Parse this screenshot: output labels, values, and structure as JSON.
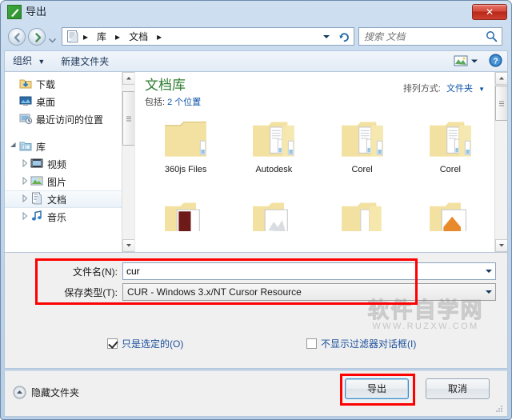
{
  "window": {
    "title": "导出",
    "icon": "export-app-icon",
    "close_label": "✕"
  },
  "nav": {
    "back_icon": "back-arrow-icon",
    "forward_icon": "forward-arrow-icon",
    "recent_icon": "recent-pages-chevron-icon",
    "address_icon": "document-library-icon",
    "breadcrumbs": [
      "库",
      "文档"
    ],
    "separator": "▸",
    "dropdown_icon": "address-dropdown-icon",
    "refresh_icon": "refresh-icon"
  },
  "search": {
    "placeholder": "搜索 文档",
    "value": "",
    "icon": "search-icon"
  },
  "command_bar": {
    "organize_label": "组织",
    "organize_arrow": "▼",
    "new_folder_label": "新建文件夹",
    "view_icon": "view-mode-icon",
    "view_arrow_icon": "view-dropdown-icon",
    "help_icon": "help-icon"
  },
  "sidebar": {
    "items": [
      {
        "label": "下载",
        "icon": "downloads-icon",
        "indent": 18,
        "expander": "",
        "selected": false
      },
      {
        "label": "桌面",
        "icon": "desktop-icon",
        "indent": 18,
        "expander": "",
        "selected": false
      },
      {
        "label": "最近访问的位置",
        "icon": "recent-places-icon",
        "indent": 18,
        "expander": "",
        "selected": false
      },
      {
        "label": "",
        "icon": "spacer",
        "indent": 0,
        "expander": "",
        "selected": false
      },
      {
        "label": "库",
        "icon": "libraries-icon",
        "indent": 4,
        "expander": "expanded",
        "selected": false
      },
      {
        "label": "视频",
        "icon": "videos-icon",
        "indent": 18,
        "expander": "collapsed",
        "selected": false
      },
      {
        "label": "图片",
        "icon": "pictures-icon",
        "indent": 18,
        "expander": "collapsed",
        "selected": false
      },
      {
        "label": "文档",
        "icon": "documents-icon",
        "indent": 18,
        "expander": "collapsed",
        "selected": true
      },
      {
        "label": "音乐",
        "icon": "music-icon",
        "indent": 18,
        "expander": "collapsed",
        "selected": false
      }
    ]
  },
  "library": {
    "title": "文档库",
    "subtitle_prefix": "包括:",
    "subtitle_link": "2 个位置",
    "arrange_label": "排列方式:",
    "arrange_value": "文件夹",
    "arrange_arrow": "▼"
  },
  "files": {
    "row1": [
      {
        "name": "360js Files",
        "icon": "folder-empty-icon"
      },
      {
        "name": "Autodesk",
        "icon": "folder-documents-icon"
      },
      {
        "name": "Corel",
        "icon": "folder-documents-icon"
      },
      {
        "name": "Corel",
        "icon": "folder-documents-icon"
      }
    ],
    "row2": [
      {
        "name": "",
        "icon": "folder-dark-preview-icon"
      },
      {
        "name": "",
        "icon": "folder-white-preview-icon"
      },
      {
        "name": "",
        "icon": "folder-plain-icon"
      },
      {
        "name": "",
        "icon": "folder-orange-preview-icon"
      }
    ]
  },
  "form": {
    "filename_label": "文件名(N):",
    "filename_value": "cur",
    "filetype_label": "保存类型(T):",
    "filetype_value": "CUR - Windows 3.x/NT Cursor Resource",
    "dropdown_icon": "chevron-down-icon"
  },
  "options": {
    "selected_only": {
      "label": "只是选定的(O)",
      "checked": true
    },
    "hide_filter_dialog": {
      "label": "不显示过滤器对话框(I)",
      "checked": false
    }
  },
  "footer": {
    "hide_folders_label": "隐藏文件夹",
    "hide_folders_icon": "collapse-up-icon",
    "export_label": "导出",
    "cancel_label": "取消",
    "resize_grip_icon": "resize-grip-icon"
  },
  "watermark": {
    "main": "软件自学网",
    "url": "WWW.RUZXW.COM"
  },
  "annotations": {
    "fields_box": "red-highlight-filename-filetype",
    "export_box": "red-highlight-export-button"
  },
  "colors": {
    "accent_blue": "#1155a8",
    "library_green": "#2e7d32",
    "annotation_red": "#ff0000",
    "close_red": "#b8281a"
  }
}
